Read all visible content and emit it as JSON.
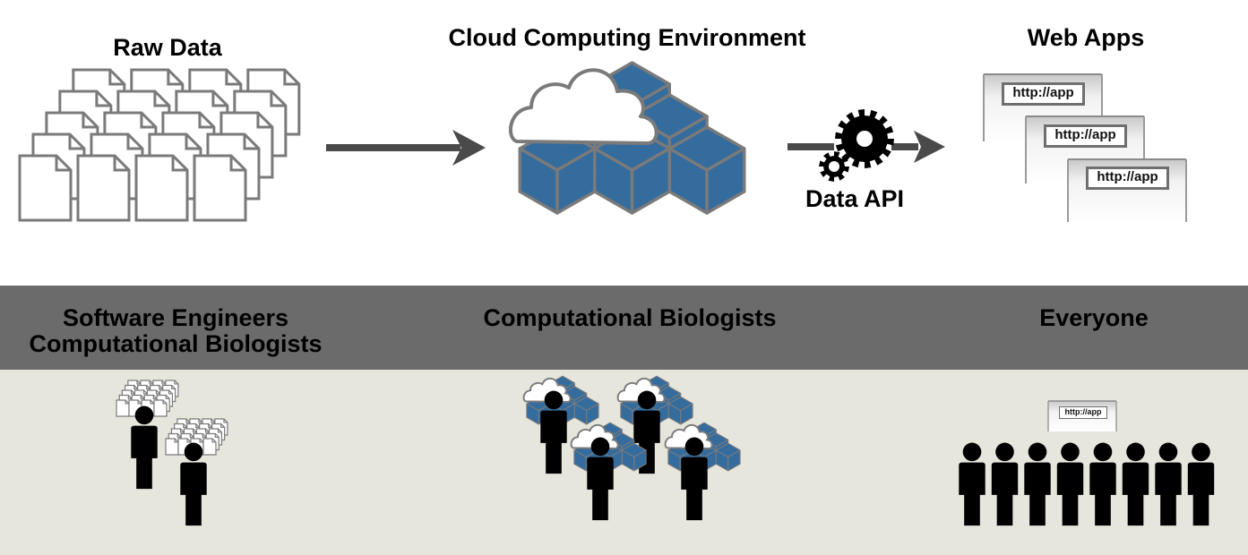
{
  "top": {
    "raw_data_title": "Raw Data",
    "cloud_title": "Cloud Computing Environment",
    "web_apps_title": "Web Apps",
    "data_api_label": "Data API",
    "app_url_labels": [
      "http://app",
      "http://app",
      "http://app"
    ]
  },
  "audience_band": {
    "left_label_line1": "Software Engineers",
    "left_label_line2": "Computational Biologists",
    "center_label": "Computational Biologists",
    "right_label": "Everyone"
  },
  "everyone_app_label": "http://app",
  "colors": {
    "cube_blue": "#346c9e",
    "outline_gray": "#7a7a7a",
    "arrow_dark": "#4a4a4a",
    "band_gray": "#6b6b6b",
    "lower_bg": "#e6e6dd",
    "person": "#000000"
  }
}
